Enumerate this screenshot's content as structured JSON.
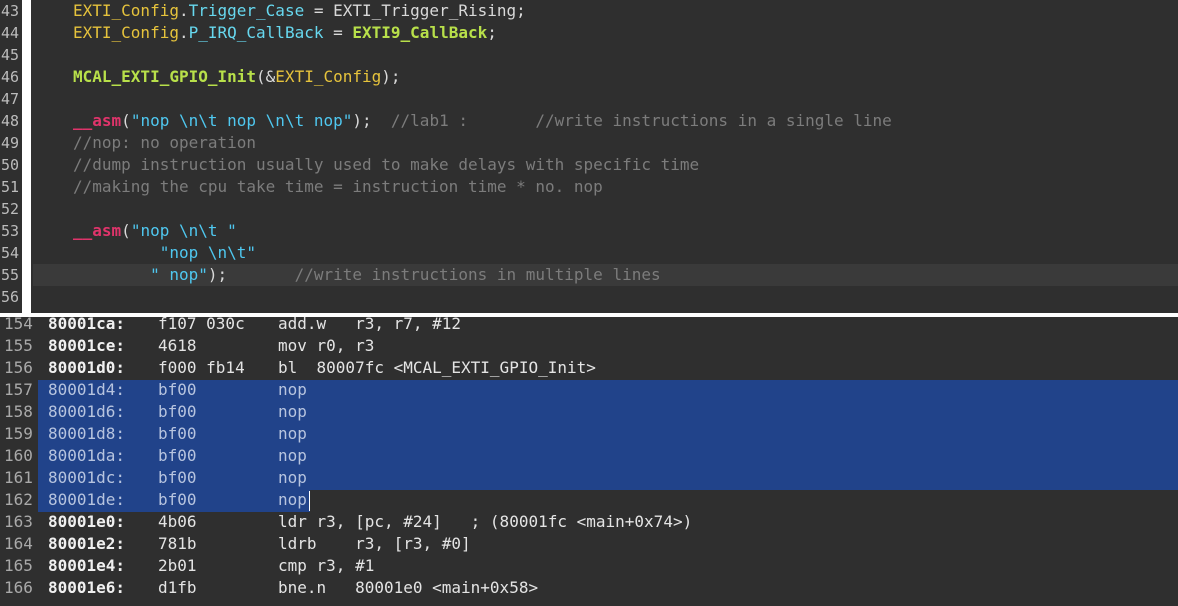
{
  "editor": {
    "lines": [
      {
        "num": "43",
        "parts": [
          [
            "yellow",
            "EXTI_Config"
          ],
          [
            "plain",
            "."
          ],
          [
            "cyan",
            "Trigger_Case"
          ],
          [
            "plain",
            " = EXTI_Trigger_Rising;"
          ]
        ]
      },
      {
        "num": "44",
        "parts": [
          [
            "yellow",
            "EXTI_Config"
          ],
          [
            "plain",
            "."
          ],
          [
            "cyan",
            "P_IRQ_CallBack"
          ],
          [
            "plain",
            " = "
          ],
          [
            "green",
            "EXTI9_CallBack"
          ],
          [
            "plain",
            ";"
          ]
        ]
      },
      {
        "num": "45",
        "parts": []
      },
      {
        "num": "46",
        "parts": [
          [
            "green",
            "MCAL_EXTI_GPIO_Init"
          ],
          [
            "plain",
            "(&"
          ],
          [
            "yellow",
            "EXTI_Config"
          ],
          [
            "plain",
            ");"
          ]
        ]
      },
      {
        "num": "47",
        "parts": []
      },
      {
        "num": "48",
        "parts": [
          [
            "asm",
            "__asm"
          ],
          [
            "plain",
            "("
          ],
          [
            "str",
            "\"nop \\n\\t nop \\n\\t nop\""
          ],
          [
            "plain",
            ");  "
          ],
          [
            "cm",
            "//lab1 :       //write instructions in a single line"
          ]
        ]
      },
      {
        "num": "49",
        "parts": [
          [
            "cm",
            "//nop: no operation"
          ]
        ]
      },
      {
        "num": "50",
        "parts": [
          [
            "cm",
            "//dump instruction usually used to make delays with specific time"
          ]
        ]
      },
      {
        "num": "51",
        "parts": [
          [
            "cm",
            "//making the cpu take time = instruction time * no. nop"
          ]
        ]
      },
      {
        "num": "52",
        "parts": []
      },
      {
        "num": "53",
        "parts": [
          [
            "asm",
            "__asm"
          ],
          [
            "plain",
            "("
          ],
          [
            "str",
            "\"nop \\n\\t \""
          ]
        ]
      },
      {
        "num": "54",
        "parts": [
          [
            "str",
            "         \"nop \\n\\t\""
          ]
        ]
      },
      {
        "num": "55",
        "parts": [
          [
            "str",
            "        \" nop\""
          ],
          [
            "plain",
            ");       "
          ],
          [
            "cm",
            "//write instructions in multiple lines"
          ]
        ]
      },
      {
        "num": "56",
        "parts": []
      }
    ]
  },
  "disassembly": {
    "rows": [
      {
        "ln": "154",
        "addr": "80001ca:",
        "hex": "f107 030c",
        "ins": "add.w   r3, r7, #12"
      },
      {
        "ln": "155",
        "addr": "80001ce:",
        "hex": "4618",
        "ins": "mov r0, r3"
      },
      {
        "ln": "156",
        "addr": "80001d0:",
        "hex": "f000 fb14",
        "ins": "bl  80007fc <MCAL_EXTI_GPIO_Init>"
      },
      {
        "ln": "157",
        "addr": "80001d4:",
        "hex": "bf00",
        "ins": "nop"
      },
      {
        "ln": "158",
        "addr": "80001d6:",
        "hex": "bf00",
        "ins": "nop"
      },
      {
        "ln": "159",
        "addr": "80001d8:",
        "hex": "bf00",
        "ins": "nop"
      },
      {
        "ln": "160",
        "addr": "80001da:",
        "hex": "bf00",
        "ins": "nop"
      },
      {
        "ln": "161",
        "addr": "80001dc:",
        "hex": "bf00",
        "ins": "nop"
      },
      {
        "ln": "162",
        "addr": "80001de:",
        "hex": "bf00",
        "ins": "nop"
      },
      {
        "ln": "163",
        "addr": "80001e0:",
        "hex": "4b06",
        "ins": "ldr r3, [pc, #24]   ; (80001fc <main+0x74>)"
      },
      {
        "ln": "164",
        "addr": "80001e2:",
        "hex": "781b",
        "ins": "ldrb    r3, [r3, #0]"
      },
      {
        "ln": "165",
        "addr": "80001e4:",
        "hex": "2b01",
        "ins": "cmp r3, #1"
      },
      {
        "ln": "166",
        "addr": "80001e6:",
        "hex": "d1fb",
        "ins": "bne.n   80001e0 <main+0x58>"
      }
    ],
    "selected_rows": [
      "157",
      "158",
      "159",
      "160",
      "161",
      "162"
    ]
  },
  "colors": {
    "editor_bg": "#2f2f2f",
    "selection": "#21438a",
    "keyword_yellow": "#e6c33c",
    "member_cyan": "#67d8ef",
    "function_green": "#b8e04a",
    "asm_red": "#e0346b",
    "string_blue": "#4fc8f0",
    "comment_gray": "#7c7c7c"
  }
}
